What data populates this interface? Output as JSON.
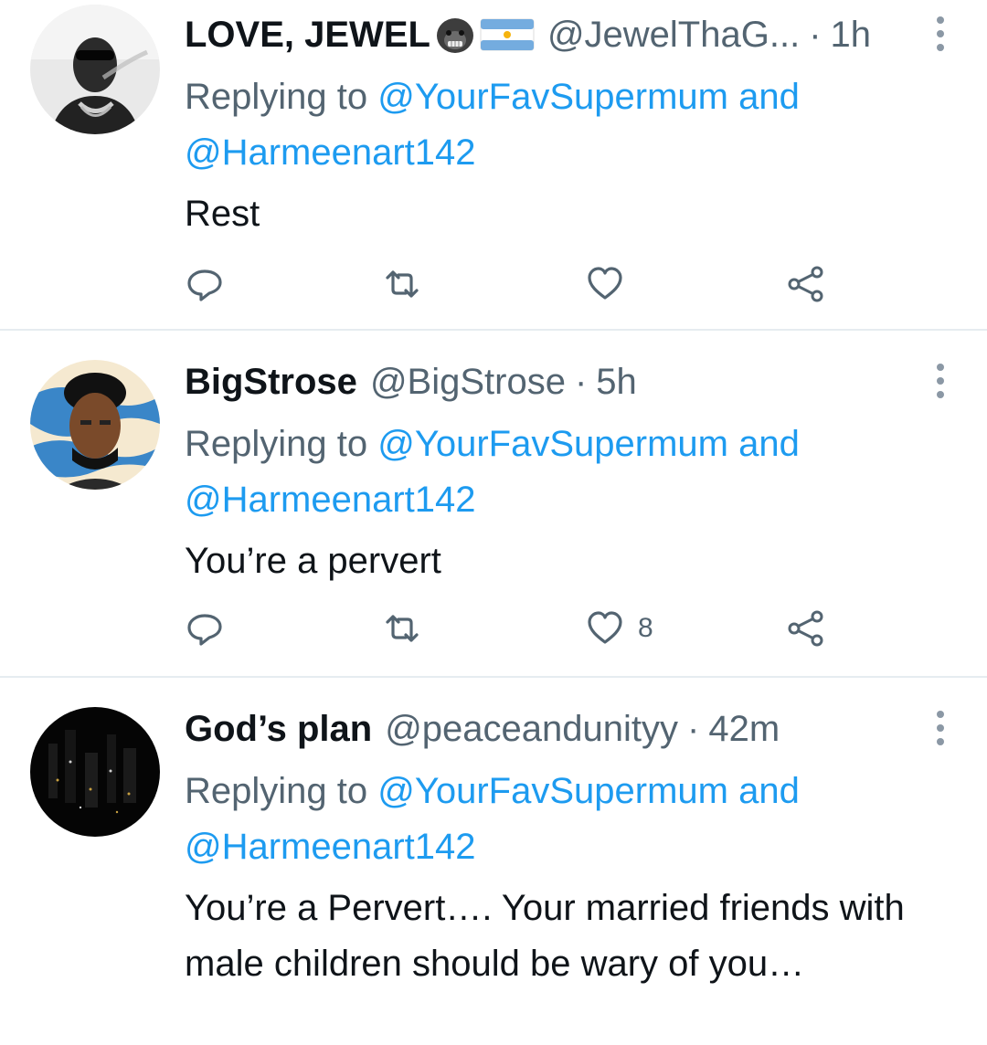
{
  "tweets": [
    {
      "name": "LOVE, JEWEL",
      "emojis": [
        "gorilla-emoji",
        "argentina-flag-emoji"
      ],
      "handle": "@JewelThaG...",
      "separator": "·",
      "time": "1h",
      "replying_prefix": "Replying to",
      "replying_to_1": "@YourFavSupermum",
      "replying_and": "and",
      "replying_to_2": "@Harmeenart142",
      "text": "Rest",
      "likes": ""
    },
    {
      "name": "BigStrose",
      "emojis": [],
      "handle": "@BigStrose",
      "separator": "·",
      "time": "5h",
      "replying_prefix": "Replying to",
      "replying_to_1": "@YourFavSupermum",
      "replying_and": "and",
      "replying_to_2": "@Harmeenart142",
      "text": "You’re a pervert",
      "likes": "8"
    },
    {
      "name": "God’s plan",
      "emojis": [],
      "handle": "@peaceandunityy",
      "separator": "·",
      "time": "42m",
      "replying_prefix": "Replying to",
      "replying_to_1": "@YourFavSupermum",
      "replying_and": "and",
      "replying_to_2": "@Harmeenart142",
      "text": "You’re a Pervert…. Your married friends with male children should be wary of you…",
      "likes": ""
    }
  ],
  "action_icons": [
    "reply-icon",
    "retweet-icon",
    "like-icon",
    "share-icon"
  ],
  "colors": {
    "link": "#1d9bf0",
    "secondary_text": "#536471",
    "primary_text": "#0f1419",
    "divider": "#e6ecf0"
  }
}
